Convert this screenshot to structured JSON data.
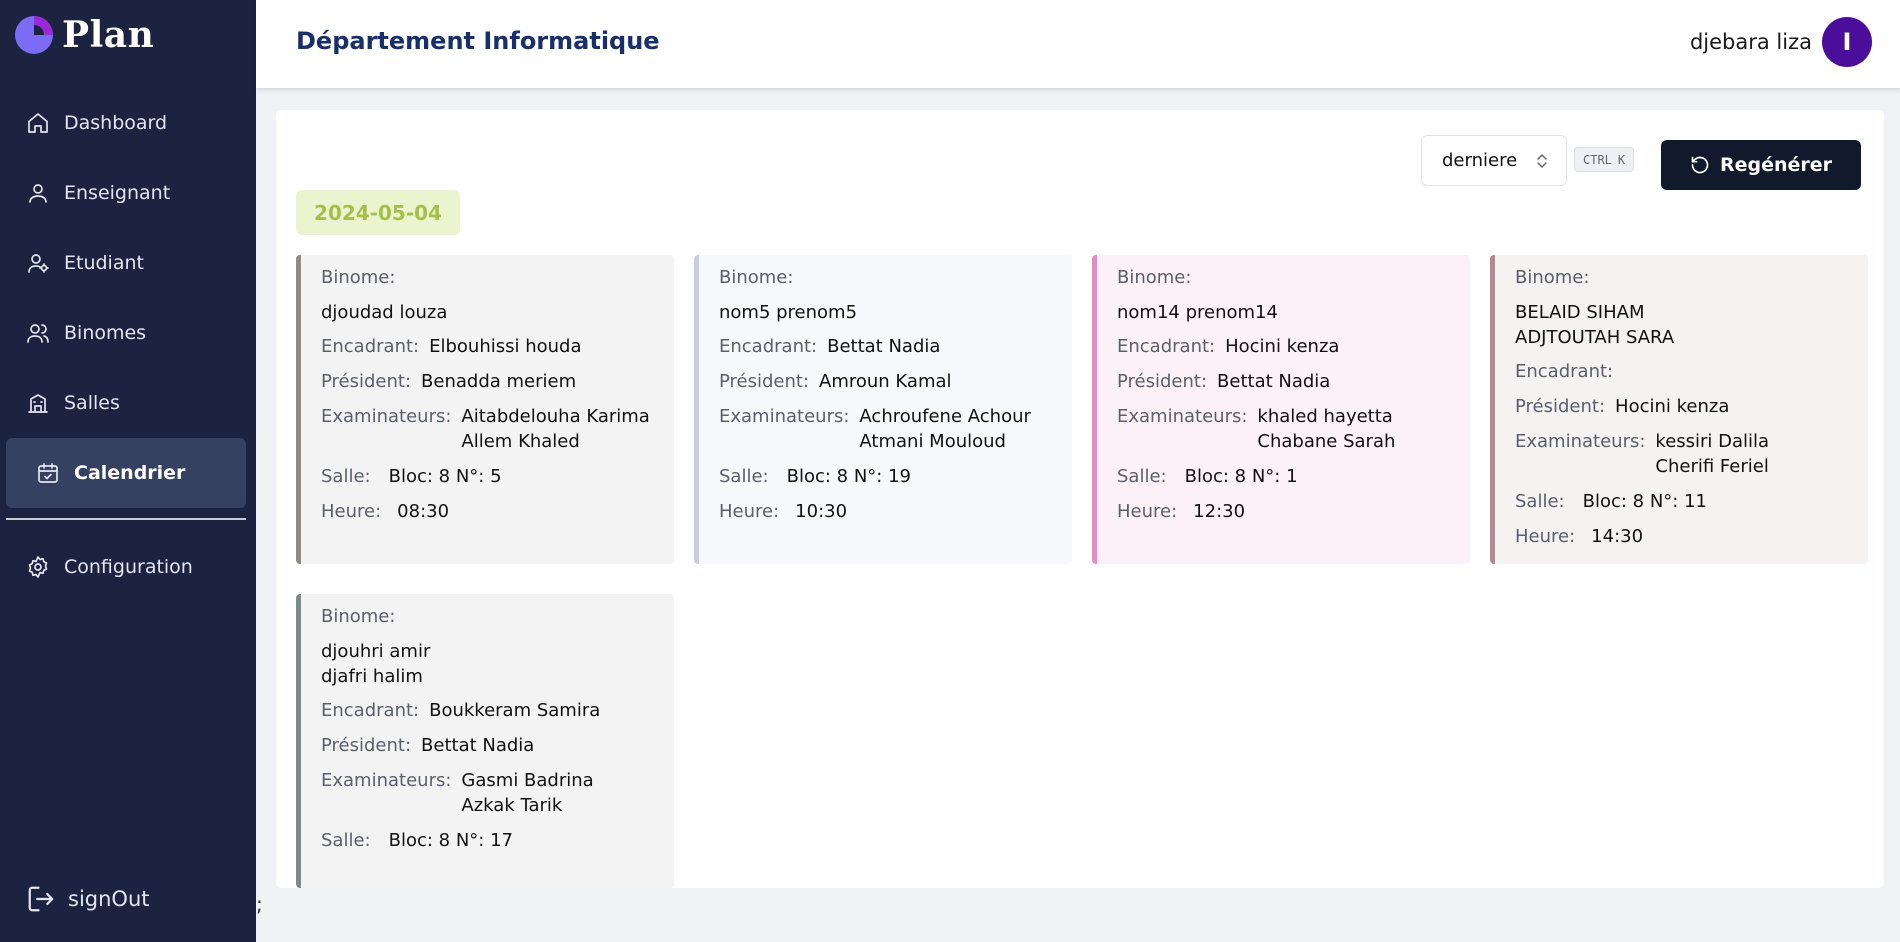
{
  "app": {
    "name": "Plan"
  },
  "nav": {
    "items": [
      {
        "label": "Dashboard",
        "icon": "home-icon"
      },
      {
        "label": "Enseignant",
        "icon": "user-icon"
      },
      {
        "label": "Etudiant",
        "icon": "user-settings-icon"
      },
      {
        "label": "Binomes",
        "icon": "users-icon"
      },
      {
        "label": "Salles",
        "icon": "building-icon"
      },
      {
        "label": "Calendrier",
        "icon": "calendar-check-icon",
        "active": true
      }
    ],
    "config_label": "Configuration",
    "signout_label": "signOut"
  },
  "stray_text": ";",
  "header": {
    "department": "Département Informatique",
    "user_name": "djebara liza",
    "avatar_letter": "I"
  },
  "toolbar": {
    "select_value": "derniere",
    "shortcut_mod": "CTRL",
    "shortcut_key": "K",
    "regen_label": "Regénérer"
  },
  "date": "2024-05-04",
  "labels": {
    "binome": "Binome:",
    "encadrant": "Encadrant:",
    "president": "Président:",
    "examinateurs": "Examinateurs:",
    "salle": "Salle:",
    "heure": "Heure:"
  },
  "cards": [
    {
      "names": [
        "djoudad louza"
      ],
      "encadrant": "Elbouhissi houda",
      "president": "Benadda meriem",
      "examinateurs": [
        "Aitabdelouha Karima",
        "Allem Khaled"
      ],
      "salle": "Bloc: 8 N°: 5",
      "heure": "08:30",
      "bg": "#f3f3f3",
      "accent": "#8d8d7a"
    },
    {
      "names": [
        "nom5 prenom5"
      ],
      "encadrant": "Bettat Nadia",
      "president": "Amroun Kamal",
      "examinateurs": [
        "Achroufene Achour",
        "Atmani Mouloud"
      ],
      "salle": "Bloc: 8 N°: 19",
      "heure": "10:30",
      "bg": "#f6f8fb",
      "accent": "#c6cde3"
    },
    {
      "names": [
        "nom14 prenom14"
      ],
      "encadrant": "Hocini kenza",
      "president": "Bettat Nadia",
      "examinateurs": [
        "khaled hayetta",
        "Chabane Sarah"
      ],
      "salle": "Bloc: 8 N°: 1",
      "heure": "12:30",
      "bg": "#fdf1f8",
      "accent": "#e88ac9"
    },
    {
      "names": [
        "BELAID SIHAM",
        "ADJTOUTAH SARA"
      ],
      "encadrant": "",
      "president": "Hocini kenza",
      "examinateurs": [
        "kessiri Dalila",
        "Cherifi Feriel"
      ],
      "salle": "Bloc: 8 N°: 11",
      "heure": "14:30",
      "bg": "#f5f2f2",
      "accent": "#b08a93"
    },
    {
      "names": [
        "djouhri amir",
        "djafri halim"
      ],
      "encadrant": "Boukkeram Samira",
      "president": "Bettat Nadia",
      "examinateurs": [
        "Gasmi Badrina",
        "Azkak Tarik"
      ],
      "salle": "Bloc: 8 N°: 17",
      "heure": "",
      "bg": "#f3f3f3",
      "accent": "#7d8a8a"
    }
  ]
}
